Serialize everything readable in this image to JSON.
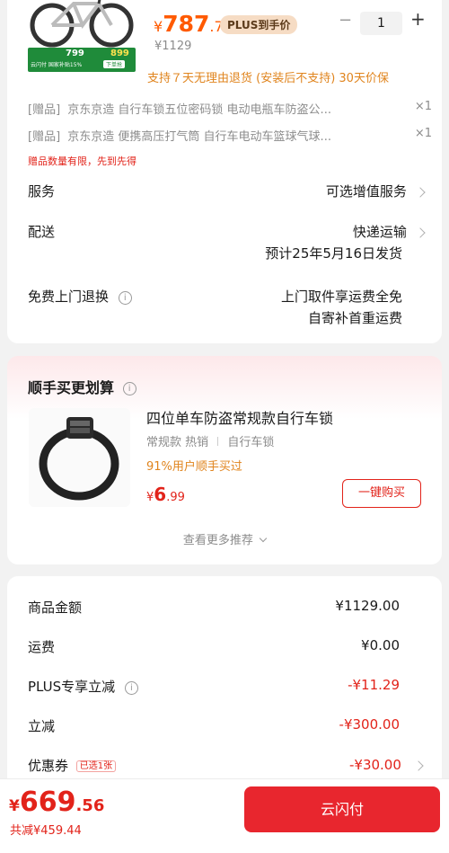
{
  "product": {
    "promo_price_prefix": "¥",
    "promo_price_int": "787",
    "promo_price_dec": ".71",
    "plus_badge": "PLUS到手价",
    "original_price": "¥1129",
    "quantity": "1",
    "minus": "−",
    "plus": "+",
    "thumb_price_a": "799",
    "thumb_price_b": "899",
    "thumb_caption": "云闪付 国家补贴15%",
    "thumb_btn": "下单抢",
    "return_policy": "支持７天无理由退货 (安装后不支持)  30天价保"
  },
  "gifts": [
    {
      "tag": "[赠品]",
      "name": "京东京造 自行车锁五位密码锁 电动电瓶车防盗公...",
      "qty": "×1"
    },
    {
      "tag": "[赠品]",
      "name": "京东京造 便携高压打气筒 自行车电动车篮球气球...",
      "qty": "×1"
    }
  ],
  "gift_notice": "赠品数量有限，先到先得",
  "service": {
    "label": "服务",
    "value": "可选增值服务"
  },
  "delivery": {
    "label": "配送",
    "value": "快递运输",
    "eta": "预计25年5月16日发货"
  },
  "free_return": {
    "label": "免费上门退换",
    "line1": "上门取件享运费全免",
    "line2": "自寄补首重运费"
  },
  "addon": {
    "title": "顺手买更划算",
    "name": "四位单车防盗常规款自行车锁",
    "tags": [
      "常规款 热销",
      "自行车锁"
    ],
    "buy_rate": "91%用户顺手买过",
    "price_prefix": "¥",
    "price_int": "6",
    "price_dec": ".99",
    "buy_button": "一键购买",
    "more": "查看更多推荐"
  },
  "summary": [
    {
      "label": "商品金额",
      "value": "¥1129.00",
      "red": false
    },
    {
      "label": "运费",
      "value": "¥0.00",
      "red": false
    },
    {
      "label": "PLUS专享立减",
      "value": "-¥11.29",
      "red": true
    },
    {
      "label": "立减",
      "value": "-¥300.00",
      "red": true
    },
    {
      "label": "优惠券",
      "badge": "已选1张",
      "value": "-¥30.00",
      "red": true
    }
  ],
  "footer": {
    "total_prefix": "¥",
    "total_int": "669",
    "total_dec": ".56",
    "saved": "共减¥459.44",
    "pay_button": "云闪付"
  },
  "colors": {
    "brand_red": "#e2231a",
    "price_orange": "#ff5a00",
    "pay_btn": "#e8262e"
  }
}
